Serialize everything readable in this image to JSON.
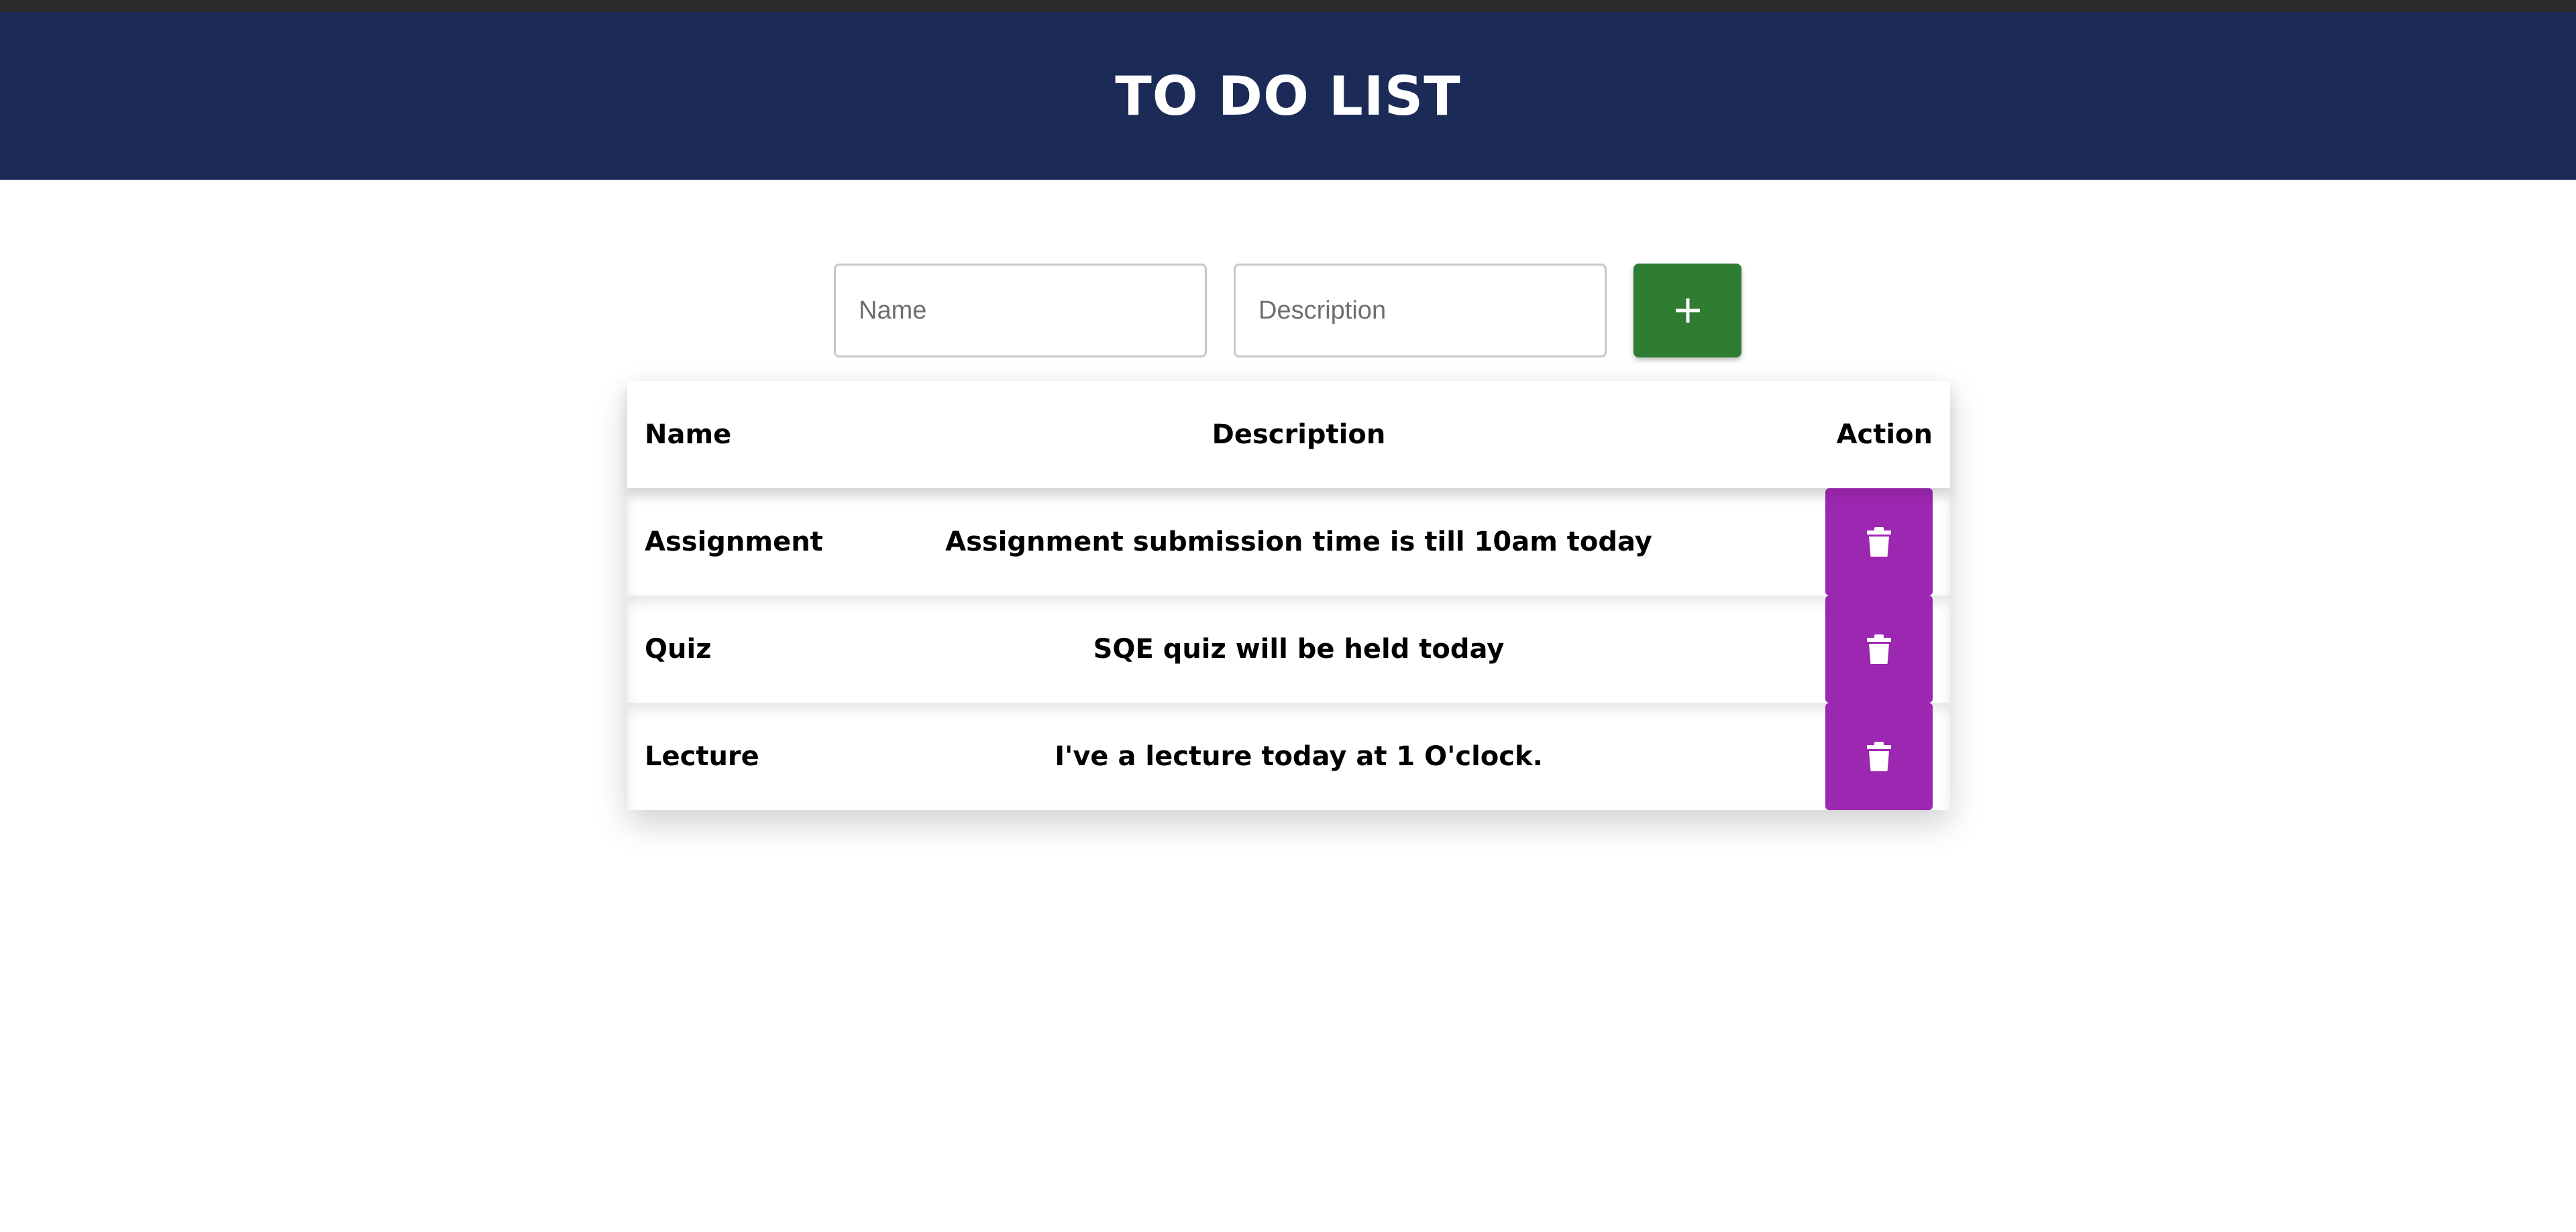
{
  "app": {
    "title": "TO DO LIST"
  },
  "form": {
    "name_placeholder": "Name",
    "name_value": "",
    "description_placeholder": "Description",
    "description_value": "",
    "add_icon": "plus-icon"
  },
  "table": {
    "headers": {
      "name": "Name",
      "description": "Description",
      "action": "Action"
    },
    "rows": [
      {
        "name": "Assignment",
        "description": "Assignment submission time is till 10am today",
        "action_icon": "trash-icon"
      },
      {
        "name": "Quiz",
        "description": "SQE quiz will be held today",
        "action_icon": "trash-icon"
      },
      {
        "name": "Lecture",
        "description": "I've a lecture today at 1 O'clock.",
        "action_icon": "trash-icon"
      }
    ]
  },
  "colors": {
    "header_bg": "#1b2a57",
    "add_button": "#2e7d32",
    "delete_button": "#9c27b0"
  }
}
